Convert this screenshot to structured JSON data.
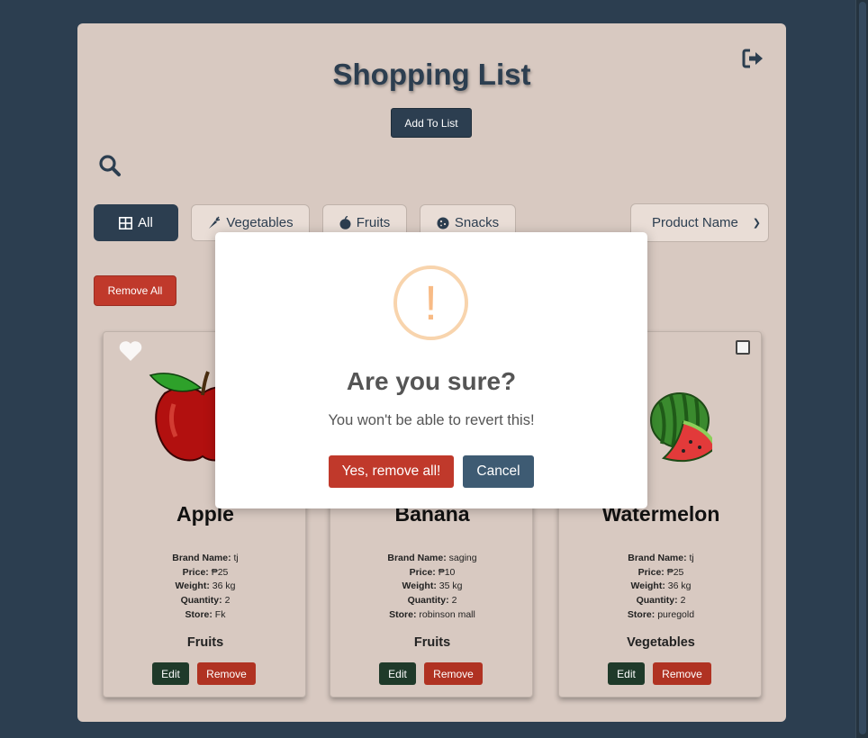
{
  "header": {
    "title": "Shopping List",
    "add_label": "Add To List",
    "logout_icon": "sign-out-icon",
    "search_icon": "search-icon"
  },
  "filters": [
    {
      "label": "All",
      "icon": "grid-icon",
      "active": true
    },
    {
      "label": "Vegetables",
      "icon": "carrot-icon",
      "active": false
    },
    {
      "label": "Fruits",
      "icon": "apple-icon",
      "active": false
    },
    {
      "label": "Snacks",
      "icon": "cookie-icon",
      "active": false
    }
  ],
  "sort": {
    "selected": "Product Name"
  },
  "remove_all_label": "Remove All",
  "labels": {
    "brand": "Brand Name:",
    "price": "Price:",
    "weight": "Weight:",
    "quantity": "Quantity:",
    "store": "Store:",
    "edit": "Edit",
    "remove": "Remove"
  },
  "cards": [
    {
      "name": "Apple",
      "brand": "tj",
      "price": "₱25",
      "weight": "36 kg",
      "quantity": "2",
      "store": "Fk",
      "category": "Fruits",
      "image": "apple-image"
    },
    {
      "name": "Banana",
      "brand": "saging",
      "price": "₱10",
      "weight": "35 kg",
      "quantity": "2",
      "store": "robinson mall",
      "category": "Fruits",
      "image": "banana-image"
    },
    {
      "name": "Watermelon",
      "brand": "tj",
      "price": "₱25",
      "weight": "36 kg",
      "quantity": "2",
      "store": "puregold",
      "category": "Vegetables",
      "image": "watermelon-image"
    }
  ],
  "modal": {
    "icon": "!",
    "title": "Are you sure?",
    "text": "You won't be able to revert this!",
    "confirm_label": "Yes, remove all!",
    "cancel_label": "Cancel"
  },
  "colors": {
    "background": "#2c3e50",
    "panel": "#d8c9c1",
    "danger": "#c0392b",
    "primary": "#2c3e50",
    "warning": "#f8bb86"
  }
}
